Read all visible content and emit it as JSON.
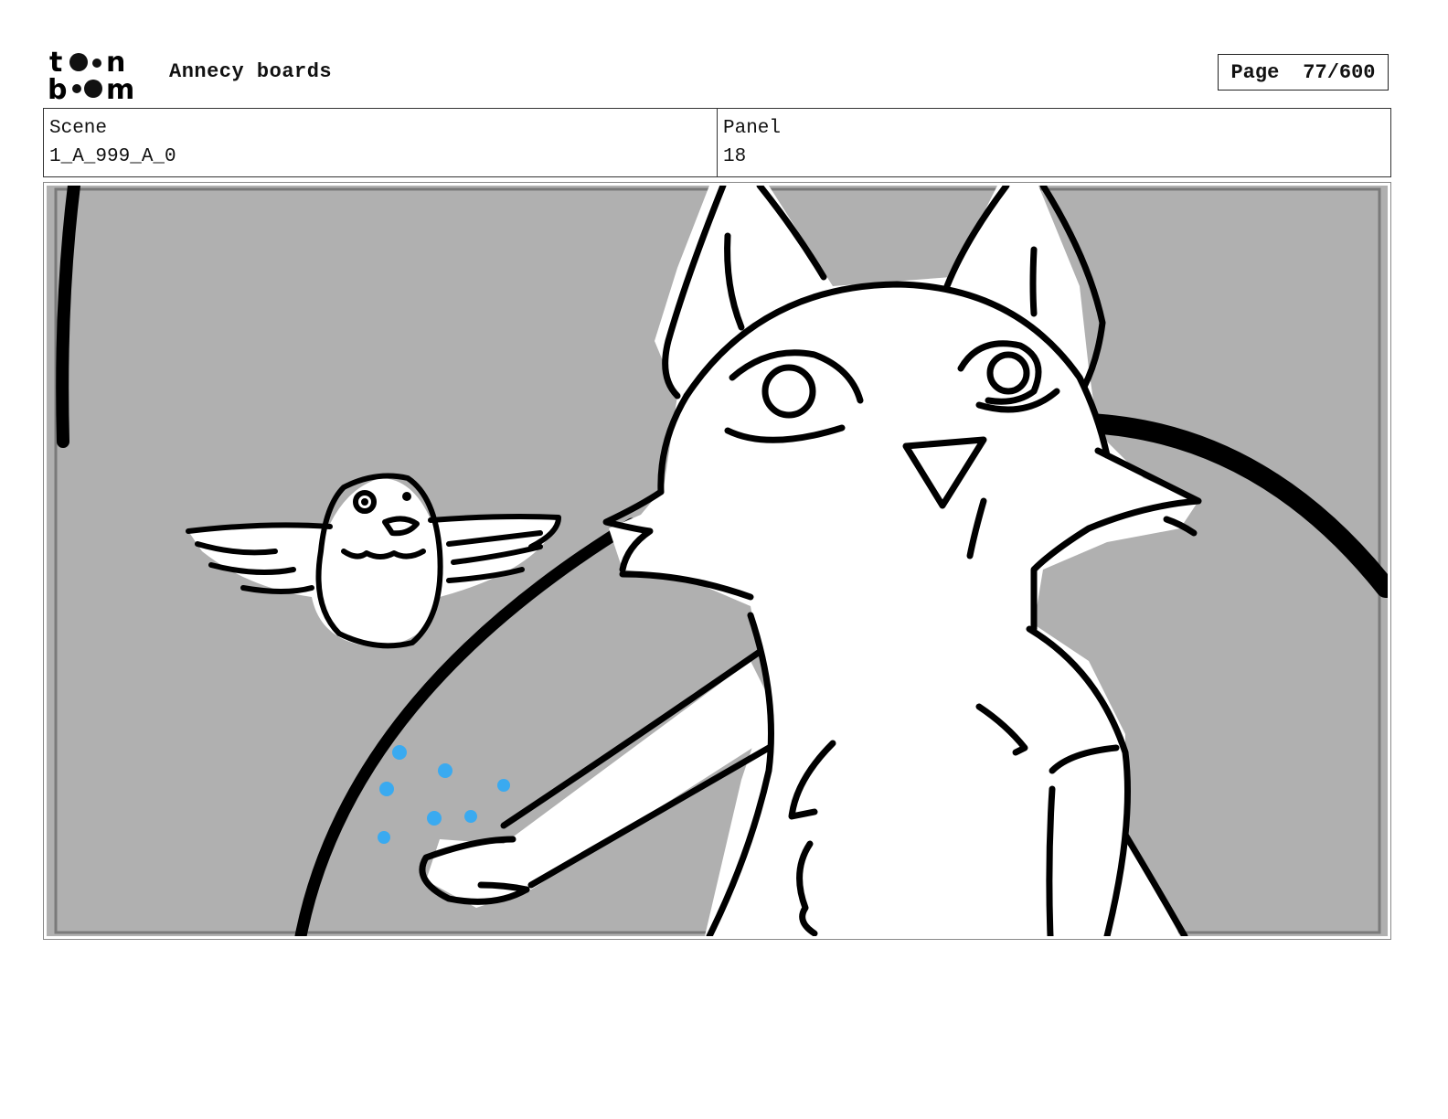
{
  "header": {
    "logo_text": "toon boom",
    "project_title": "Annecy boards",
    "page_label": "Page",
    "page_value": "77/600"
  },
  "info": {
    "scene_label": "Scene",
    "scene_value": "1_A_999_A_0",
    "panel_label": "Panel",
    "panel_value": "18"
  },
  "colors": {
    "panel_background": "#b0b0b0",
    "ink": "#000000",
    "droplets": "#3aaaf0"
  }
}
